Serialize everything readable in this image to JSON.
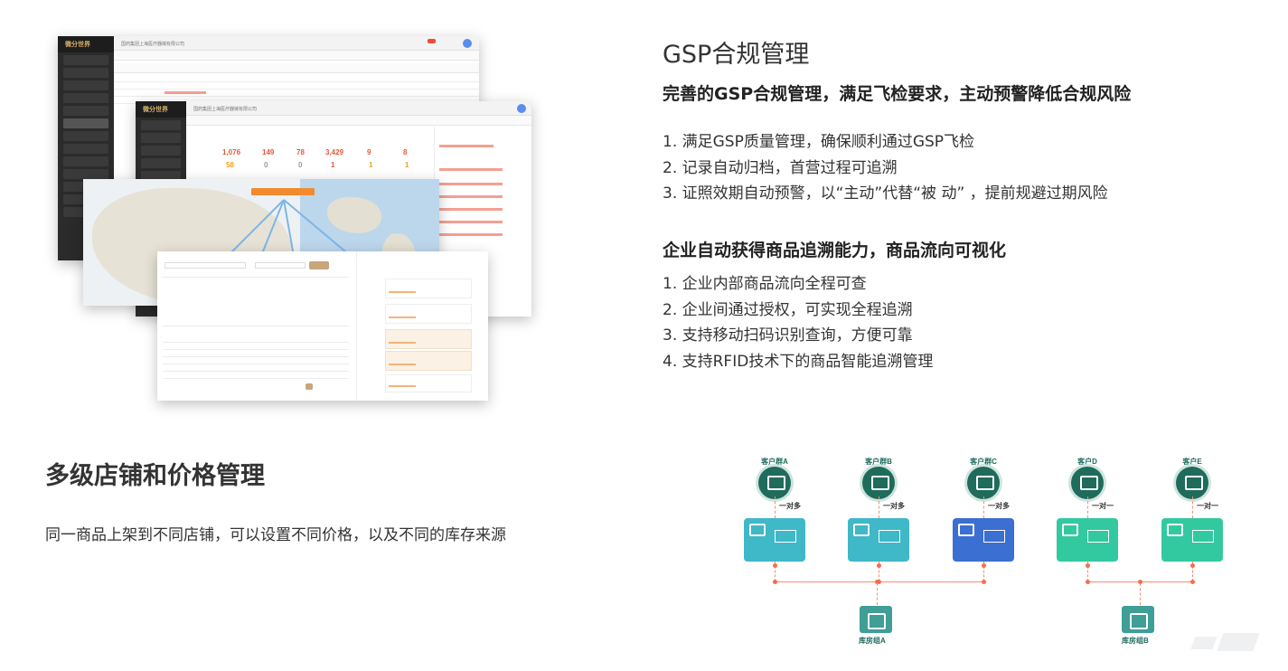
{
  "gsp": {
    "title": "GSP合规管理",
    "subtitle": "完善的GSP合规管理，满足飞检要求，主动预警降低合规风险",
    "points": [
      "1. 满足GSP质量管理，确保顺利通过GSP飞检",
      "2. 记录自动归档，首营过程可追溯",
      "3. 证照效期自动预警，以“主动”代替“被 动” ，提前规避过期风险"
    ],
    "subtitle2": "企业自动获得商品追溯能力，商品流向可视化",
    "points2": [
      "1. 企业内部商品流向全程可查",
      "2. 企业间通过授权，可实现全程追溯",
      "3. 支持移动扫码识别查询，方便可靠",
      "4. 支持RFID技术下的商品智能追溯管理"
    ]
  },
  "store": {
    "title": "多级店铺和价格管理",
    "description": "同一商品上架到不同店铺，可以设置不同价格，以及不同的库存来源"
  },
  "screenshot": {
    "logo": "微分世界",
    "company": "国药集团上海医疗器械有限公司",
    "stats": [
      "1,076",
      "149",
      "78",
      "3,429",
      "9",
      "8"
    ],
    "stats2": [
      "58",
      "0",
      "0",
      "1",
      "1",
      "1"
    ]
  },
  "diagram": {
    "customers": [
      "客户群A",
      "客户群B",
      "客户群C",
      "客户D",
      "客户E"
    ],
    "relations": [
      "一对多",
      "一对多",
      "一对多",
      "一对一",
      "一对一"
    ],
    "warehouses": [
      "库房组A",
      "库房组B"
    ],
    "colors": {
      "teal": "#3fb8c8",
      "blue": "#3b6fd1",
      "green": "#33c9a0",
      "dark": "#1f6b5c"
    }
  }
}
